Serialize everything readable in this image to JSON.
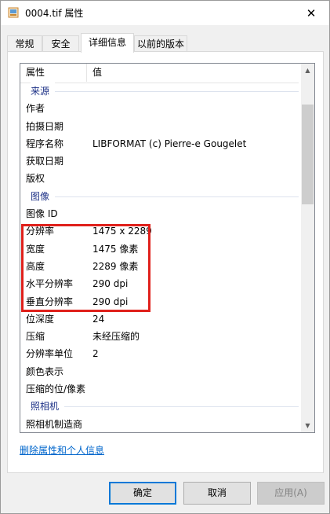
{
  "window": {
    "title": "0004.tif 属性",
    "close_glyph": "✕"
  },
  "tabs": [
    "常规",
    "安全",
    "详细信息",
    "以前的版本"
  ],
  "active_tab": "详细信息",
  "list": {
    "columns": [
      "属性",
      "值"
    ],
    "rows": [
      {
        "type": "group",
        "label": "来源"
      },
      {
        "type": "prop",
        "key": "作者",
        "value": ""
      },
      {
        "type": "prop",
        "key": "拍摄日期",
        "value": ""
      },
      {
        "type": "prop",
        "key": "程序名称",
        "value": "LIBFORMAT (c) Pierre-e Gougelet"
      },
      {
        "type": "prop",
        "key": "获取日期",
        "value": ""
      },
      {
        "type": "prop",
        "key": "版权",
        "value": ""
      },
      {
        "type": "group",
        "label": "图像"
      },
      {
        "type": "prop",
        "key": "图像 ID",
        "value": ""
      },
      {
        "type": "prop",
        "key": "分辨率",
        "value": "1475 x 2289"
      },
      {
        "type": "prop",
        "key": "宽度",
        "value": "1475 像素"
      },
      {
        "type": "prop",
        "key": "高度",
        "value": "2289 像素"
      },
      {
        "type": "prop",
        "key": "水平分辨率",
        "value": "290 dpi"
      },
      {
        "type": "prop",
        "key": "垂直分辨率",
        "value": "290 dpi"
      },
      {
        "type": "prop",
        "key": "位深度",
        "value": "24"
      },
      {
        "type": "prop",
        "key": "压缩",
        "value": "未经压缩的"
      },
      {
        "type": "prop",
        "key": "分辨率单位",
        "value": "2"
      },
      {
        "type": "prop",
        "key": "颜色表示",
        "value": ""
      },
      {
        "type": "prop",
        "key": "压缩的位/像素",
        "value": ""
      },
      {
        "type": "group",
        "label": "照相机"
      },
      {
        "type": "prop",
        "key": "照相机制造商",
        "value": ""
      }
    ]
  },
  "link_text": "删除属性和个人信息",
  "buttons": {
    "ok": "确定",
    "cancel": "取消",
    "apply": "应用(A)"
  },
  "colors": {
    "highlight": "#e0201b",
    "group_label": "#1e3287",
    "link": "#0066cc",
    "default_button_border": "#0078d7"
  },
  "icons": {
    "file": "file-icon",
    "scroll_up": "chevron-up-icon",
    "scroll_down": "chevron-down-icon"
  }
}
